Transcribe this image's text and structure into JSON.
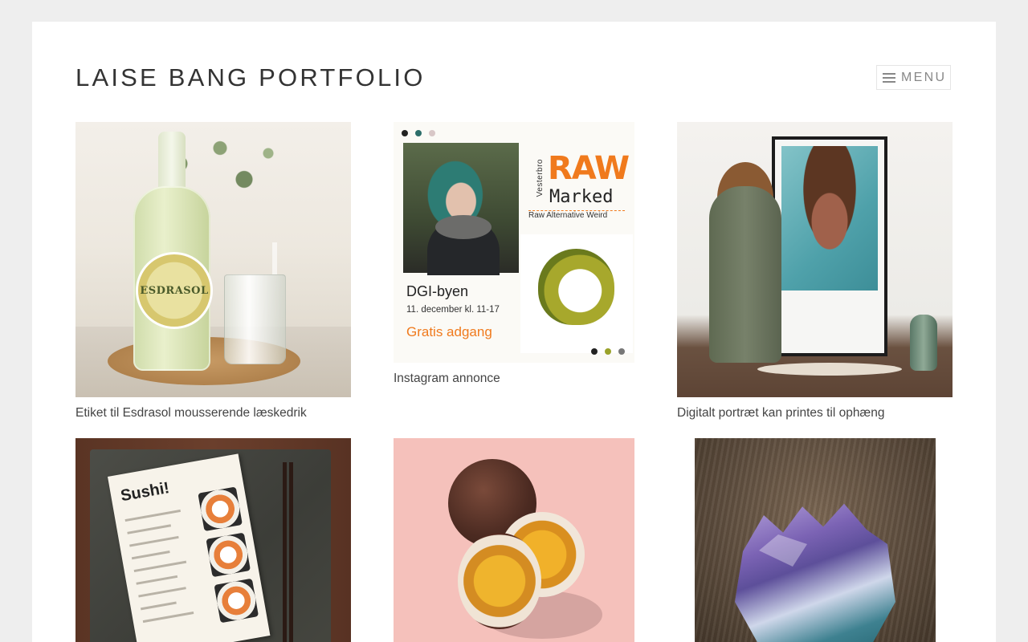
{
  "site": {
    "title": "LAISE BANG PORTFOLIO",
    "menu_label": "MENU"
  },
  "portfolio": {
    "items": [
      {
        "caption": "Etiket til Esdrasol mousserende læskedrik",
        "image_text": "ESDRASOL"
      },
      {
        "caption": "Instagram annonce",
        "image_text": {
          "vesterbro": "Vesterbro",
          "raw": "RAW",
          "marked": "Marked",
          "tagline": "Raw Alternative Weird",
          "venue": "DGI-byen",
          "date": "11. december kl. 11-17",
          "admission": "Gratis adgang"
        }
      },
      {
        "caption": "Digitalt portræt kan printes til ophæng"
      },
      {
        "caption": "",
        "image_text": {
          "title": "Sushi!"
        }
      },
      {
        "caption": ""
      },
      {
        "caption": ""
      }
    ]
  },
  "colors": {
    "page_background": "#eeeeee",
    "content_background": "#ffffff",
    "title": "#333333",
    "menu": "#888888",
    "caption": "#444444",
    "raw_orange": "#f07a1d"
  },
  "icons": {
    "menu": "hamburger-icon"
  }
}
